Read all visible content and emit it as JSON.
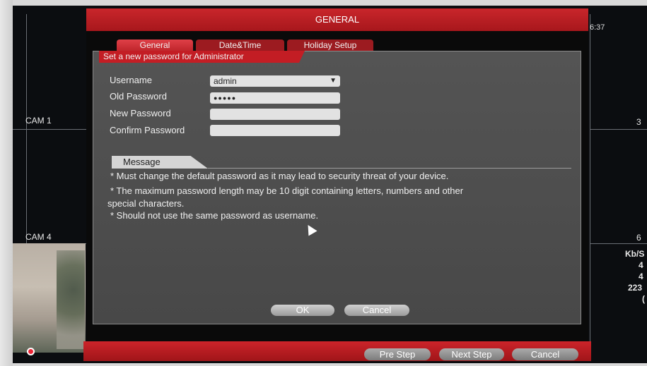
{
  "window": {
    "title": "GENERAL",
    "clock": "6:37"
  },
  "tabs": [
    {
      "label": "General"
    },
    {
      "label": "Date&Time"
    },
    {
      "label": "Holiday Setup"
    }
  ],
  "panel": {
    "heading": "Set a new password for Administrator"
  },
  "form": {
    "username_label": "Username",
    "username_value": "admin",
    "old_password_label": "Old Password",
    "old_password_value": "●●●●●",
    "new_password_label": "New Password",
    "confirm_password_label": "Confirm Password"
  },
  "message": {
    "tab_label": "Message",
    "lines": [
      "* Must change the default password as it may lead to security threat of your device.",
      "* The maximum password length may be 10 digit containing letters, numbers and other",
      "special characters.",
      "* Should not use the same password as username."
    ]
  },
  "actions": {
    "ok": "OK",
    "cancel": "Cancel"
  },
  "footer": {
    "pre_step": "Pre Step",
    "next_step": "Next Step",
    "cancel": "Cancel"
  },
  "cameras": {
    "cam1": "CAM 1",
    "cam4": "CAM 4",
    "right3": "3",
    "right6": "6"
  },
  "stats": [
    "Kb/S",
    "4",
    "4",
    "223",
    "("
  ]
}
